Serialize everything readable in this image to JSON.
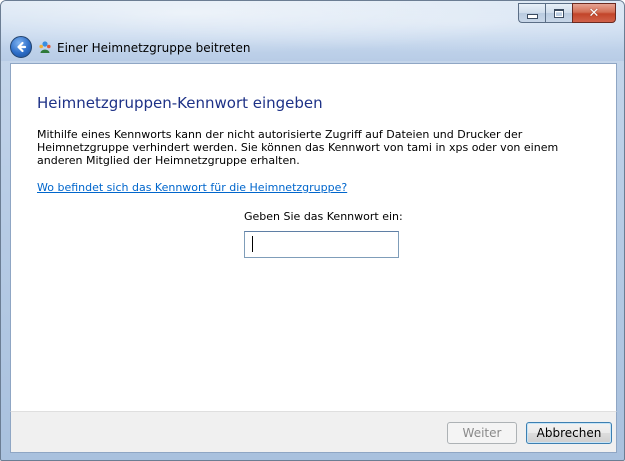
{
  "window": {
    "title": "Einer Heimnetzgruppe beitreten",
    "controls": {
      "minimize": "minimize",
      "maximize": "maximize",
      "close": "close"
    }
  },
  "content": {
    "heading": "Heimnetzgruppen-Kennwort eingeben",
    "description": "Mithilfe eines Kennworts kann der nicht autorisierte Zugriff auf Dateien und Drucker der Heimnetzgruppe verhindert werden. Sie können das Kennwort von tami in xps oder von einem anderen Mitglied der Heimnetzgruppe erhalten.",
    "help_link": "Wo befindet sich das Kennwort für die Heimnetzgruppe?",
    "password_label": "Geben Sie das Kennwort ein:",
    "password_value": "",
    "password_placeholder": ""
  },
  "footer": {
    "next_label": "Weiter",
    "cancel_label": "Abbrechen"
  },
  "icons": {
    "back": "back-arrow-icon",
    "homegroup": "homegroup-icon"
  },
  "colors": {
    "heading": "#1e3287",
    "link": "#0066cc",
    "accent": "#3c7fb1",
    "close_button": "#c2452a"
  }
}
